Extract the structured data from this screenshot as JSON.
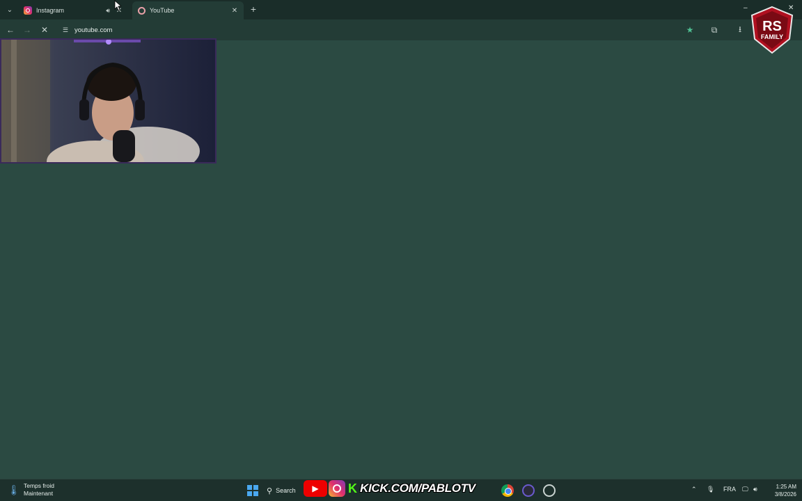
{
  "browser": {
    "tabs": [
      {
        "title": "Instagram",
        "icon": "instagram-icon",
        "audio": true,
        "active": false
      },
      {
        "title": "YouTube",
        "icon": "youtube-icon",
        "audio": false,
        "active": true
      }
    ],
    "address": "youtube.com",
    "bookmarked": true
  },
  "overlay": {
    "logo_line1": "RS",
    "logo_line2": "FAMILY"
  },
  "taskbar": {
    "weather_title": "Temps froid",
    "weather_subtitle": "Maintenant",
    "search_label": "Search",
    "kick_letter": "K",
    "kick_url": "KICK.COM/PABLOTV",
    "language": "FRA",
    "time": "1:25 AM",
    "date": "3/8/2026"
  },
  "colors": {
    "page_bg": "#2b4a42",
    "tabstrip_bg": "#1a2d29",
    "toolbar_bg": "#233c36",
    "kick_green": "#53fc18",
    "youtube_red": "#e00000"
  }
}
